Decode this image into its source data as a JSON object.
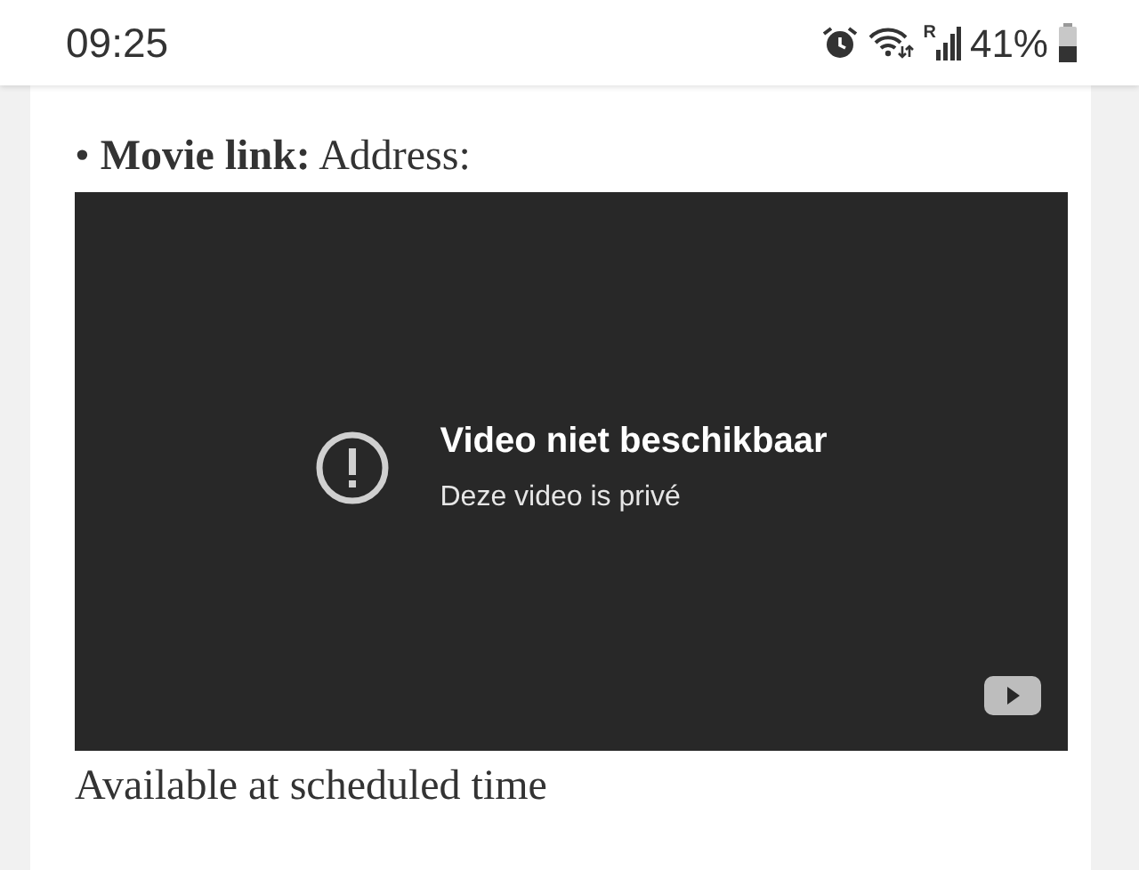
{
  "status_bar": {
    "time": "09:25",
    "network_letter": "R",
    "battery": "41%"
  },
  "content": {
    "link_line": "• **Movie link:** Address:",
    "video": {
      "title": "Video niet beschikbaar",
      "message": "Deze video is privé"
    },
    "caption": "Available at scheduled time"
  }
}
